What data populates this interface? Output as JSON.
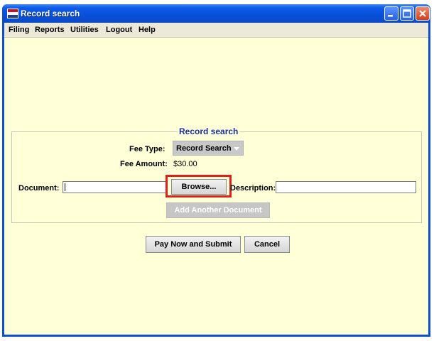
{
  "window": {
    "title": "Record search",
    "icon": "app-flag-icon"
  },
  "menu": {
    "items": [
      "Filing",
      "Reports",
      "Utilities",
      "Logout",
      "Help"
    ]
  },
  "form": {
    "section_title": "Record search",
    "fee_type_label": "Fee Type:",
    "fee_type_value": "Record Search",
    "fee_amount_label": "Fee Amount:",
    "fee_amount_value": "$30.00",
    "document_label": "Document:",
    "document_value": "",
    "browse_label": "Browse...",
    "description_label": "Description:",
    "description_value": "",
    "add_document_label": "Add Another Document"
  },
  "actions": {
    "pay_label": "Pay Now and Submit",
    "cancel_label": "Cancel"
  },
  "colors": {
    "titlebar": "#0850d8",
    "client_background": "#ffffd8",
    "section_title": "#1a2ea0",
    "highlight": "#e0201a"
  }
}
